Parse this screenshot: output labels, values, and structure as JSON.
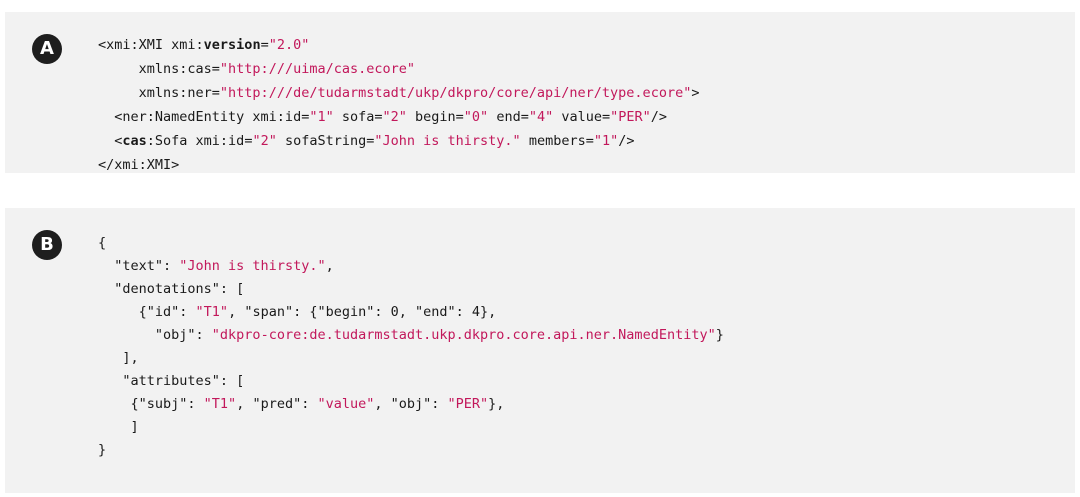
{
  "panel_a": {
    "badge": "A",
    "lines": [
      [
        {
          "t": "<xmi:XMI xmi:"
        },
        {
          "t": "version",
          "c": "kw"
        },
        {
          "t": "="
        },
        {
          "t": "\"2.0\"",
          "c": "str"
        }
      ],
      [
        {
          "t": "     xmlns:cas="
        },
        {
          "t": "\"http:///uima/cas.ecore\"",
          "c": "str"
        }
      ],
      [
        {
          "t": "     xmlns:ner="
        },
        {
          "t": "\"http:///de/tudarmstadt/ukp/dkpro/core/api/ner/type.ecore\"",
          "c": "str"
        },
        {
          "t": ">"
        }
      ],
      [
        {
          "t": "  <ner:NamedEntity xmi:id="
        },
        {
          "t": "\"1\"",
          "c": "str"
        },
        {
          "t": " sofa="
        },
        {
          "t": "\"2\"",
          "c": "str"
        },
        {
          "t": " begin="
        },
        {
          "t": "\"0\"",
          "c": "str"
        },
        {
          "t": " end="
        },
        {
          "t": "\"4\"",
          "c": "str"
        },
        {
          "t": " value="
        },
        {
          "t": "\"PER\"",
          "c": "str"
        },
        {
          "t": "/>"
        }
      ],
      [
        {
          "t": "  <"
        },
        {
          "t": "cas",
          "c": "kw"
        },
        {
          "t": ":Sofa xmi:id="
        },
        {
          "t": "\"2\"",
          "c": "str"
        },
        {
          "t": " sofaString="
        },
        {
          "t": "\"John is thirsty.\"",
          "c": "str"
        },
        {
          "t": " members="
        },
        {
          "t": "\"1\"",
          "c": "str"
        },
        {
          "t": "/>"
        }
      ],
      [
        {
          "t": "</xmi:XMI>"
        }
      ]
    ]
  },
  "panel_b": {
    "badge": "B",
    "lines": [
      [
        {
          "t": "{"
        }
      ],
      [
        {
          "t": "  \"text\": "
        },
        {
          "t": "\"John is thirsty.\"",
          "c": "str"
        },
        {
          "t": ","
        }
      ],
      [
        {
          "t": "  \"denotations\": ["
        }
      ],
      [
        {
          "t": "     {\"id\": "
        },
        {
          "t": "\"T1\"",
          "c": "str"
        },
        {
          "t": ", \"span\": {\"begin\": 0, \"end\": 4},"
        }
      ],
      [
        {
          "t": "       \"obj\": "
        },
        {
          "t": "\"dkpro-core:de.tudarmstadt.ukp.dkpro.core.api.ner.NamedEntity\"",
          "c": "str"
        },
        {
          "t": "}"
        }
      ],
      [
        {
          "t": "   ],"
        }
      ],
      [
        {
          "t": "   \"attributes\": ["
        }
      ],
      [
        {
          "t": "    {\"subj\": "
        },
        {
          "t": "\"T1\"",
          "c": "str"
        },
        {
          "t": ", \"pred\": "
        },
        {
          "t": "\"value\"",
          "c": "str"
        },
        {
          "t": ", \"obj\": "
        },
        {
          "t": "\"PER\"",
          "c": "str"
        },
        {
          "t": "},"
        }
      ],
      [
        {
          "t": "    ]"
        }
      ],
      [
        {
          "t": "}"
        }
      ]
    ]
  }
}
